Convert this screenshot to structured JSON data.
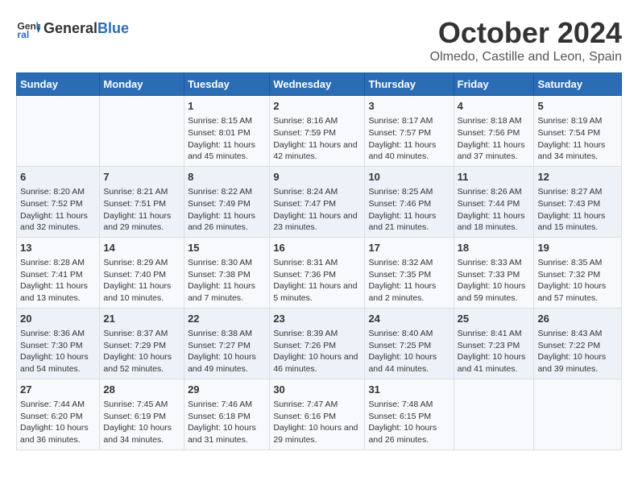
{
  "header": {
    "logo_general": "General",
    "logo_blue": "Blue",
    "month_year": "October 2024",
    "location": "Olmedo, Castille and Leon, Spain"
  },
  "days_of_week": [
    "Sunday",
    "Monday",
    "Tuesday",
    "Wednesday",
    "Thursday",
    "Friday",
    "Saturday"
  ],
  "weeks": [
    [
      {
        "day": "",
        "info": ""
      },
      {
        "day": "",
        "info": ""
      },
      {
        "day": "1",
        "info": "Sunrise: 8:15 AM\nSunset: 8:01 PM\nDaylight: 11 hours and 45 minutes."
      },
      {
        "day": "2",
        "info": "Sunrise: 8:16 AM\nSunset: 7:59 PM\nDaylight: 11 hours and 42 minutes."
      },
      {
        "day": "3",
        "info": "Sunrise: 8:17 AM\nSunset: 7:57 PM\nDaylight: 11 hours and 40 minutes."
      },
      {
        "day": "4",
        "info": "Sunrise: 8:18 AM\nSunset: 7:56 PM\nDaylight: 11 hours and 37 minutes."
      },
      {
        "day": "5",
        "info": "Sunrise: 8:19 AM\nSunset: 7:54 PM\nDaylight: 11 hours and 34 minutes."
      }
    ],
    [
      {
        "day": "6",
        "info": "Sunrise: 8:20 AM\nSunset: 7:52 PM\nDaylight: 11 hours and 32 minutes."
      },
      {
        "day": "7",
        "info": "Sunrise: 8:21 AM\nSunset: 7:51 PM\nDaylight: 11 hours and 29 minutes."
      },
      {
        "day": "8",
        "info": "Sunrise: 8:22 AM\nSunset: 7:49 PM\nDaylight: 11 hours and 26 minutes."
      },
      {
        "day": "9",
        "info": "Sunrise: 8:24 AM\nSunset: 7:47 PM\nDaylight: 11 hours and 23 minutes."
      },
      {
        "day": "10",
        "info": "Sunrise: 8:25 AM\nSunset: 7:46 PM\nDaylight: 11 hours and 21 minutes."
      },
      {
        "day": "11",
        "info": "Sunrise: 8:26 AM\nSunset: 7:44 PM\nDaylight: 11 hours and 18 minutes."
      },
      {
        "day": "12",
        "info": "Sunrise: 8:27 AM\nSunset: 7:43 PM\nDaylight: 11 hours and 15 minutes."
      }
    ],
    [
      {
        "day": "13",
        "info": "Sunrise: 8:28 AM\nSunset: 7:41 PM\nDaylight: 11 hours and 13 minutes."
      },
      {
        "day": "14",
        "info": "Sunrise: 8:29 AM\nSunset: 7:40 PM\nDaylight: 11 hours and 10 minutes."
      },
      {
        "day": "15",
        "info": "Sunrise: 8:30 AM\nSunset: 7:38 PM\nDaylight: 11 hours and 7 minutes."
      },
      {
        "day": "16",
        "info": "Sunrise: 8:31 AM\nSunset: 7:36 PM\nDaylight: 11 hours and 5 minutes."
      },
      {
        "day": "17",
        "info": "Sunrise: 8:32 AM\nSunset: 7:35 PM\nDaylight: 11 hours and 2 minutes."
      },
      {
        "day": "18",
        "info": "Sunrise: 8:33 AM\nSunset: 7:33 PM\nDaylight: 10 hours and 59 minutes."
      },
      {
        "day": "19",
        "info": "Sunrise: 8:35 AM\nSunset: 7:32 PM\nDaylight: 10 hours and 57 minutes."
      }
    ],
    [
      {
        "day": "20",
        "info": "Sunrise: 8:36 AM\nSunset: 7:30 PM\nDaylight: 10 hours and 54 minutes."
      },
      {
        "day": "21",
        "info": "Sunrise: 8:37 AM\nSunset: 7:29 PM\nDaylight: 10 hours and 52 minutes."
      },
      {
        "day": "22",
        "info": "Sunrise: 8:38 AM\nSunset: 7:27 PM\nDaylight: 10 hours and 49 minutes."
      },
      {
        "day": "23",
        "info": "Sunrise: 8:39 AM\nSunset: 7:26 PM\nDaylight: 10 hours and 46 minutes."
      },
      {
        "day": "24",
        "info": "Sunrise: 8:40 AM\nSunset: 7:25 PM\nDaylight: 10 hours and 44 minutes."
      },
      {
        "day": "25",
        "info": "Sunrise: 8:41 AM\nSunset: 7:23 PM\nDaylight: 10 hours and 41 minutes."
      },
      {
        "day": "26",
        "info": "Sunrise: 8:43 AM\nSunset: 7:22 PM\nDaylight: 10 hours and 39 minutes."
      }
    ],
    [
      {
        "day": "27",
        "info": "Sunrise: 7:44 AM\nSunset: 6:20 PM\nDaylight: 10 hours and 36 minutes."
      },
      {
        "day": "28",
        "info": "Sunrise: 7:45 AM\nSunset: 6:19 PM\nDaylight: 10 hours and 34 minutes."
      },
      {
        "day": "29",
        "info": "Sunrise: 7:46 AM\nSunset: 6:18 PM\nDaylight: 10 hours and 31 minutes."
      },
      {
        "day": "30",
        "info": "Sunrise: 7:47 AM\nSunset: 6:16 PM\nDaylight: 10 hours and 29 minutes."
      },
      {
        "day": "31",
        "info": "Sunrise: 7:48 AM\nSunset: 6:15 PM\nDaylight: 10 hours and 26 minutes."
      },
      {
        "day": "",
        "info": ""
      },
      {
        "day": "",
        "info": ""
      }
    ]
  ]
}
